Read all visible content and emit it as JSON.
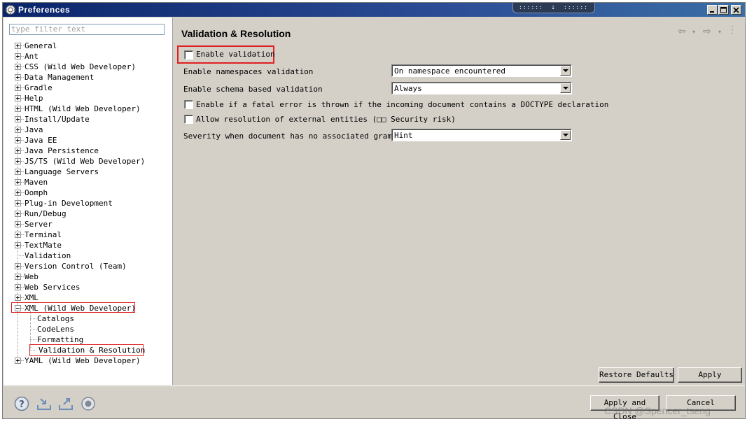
{
  "window": {
    "title": "Preferences",
    "controls": [
      "minimize-icon",
      "maximize-icon",
      "close-icon"
    ]
  },
  "filter": {
    "placeholder": "type filter text"
  },
  "tree": [
    {
      "label": "General",
      "expander": "plus"
    },
    {
      "label": "Ant",
      "expander": "plus"
    },
    {
      "label": "CSS (Wild Web Developer)",
      "expander": "plus"
    },
    {
      "label": "Data Management",
      "expander": "plus"
    },
    {
      "label": "Gradle",
      "expander": "plus"
    },
    {
      "label": "Help",
      "expander": "plus"
    },
    {
      "label": "HTML (Wild Web Developer)",
      "expander": "plus"
    },
    {
      "label": "Install/Update",
      "expander": "plus"
    },
    {
      "label": "Java",
      "expander": "plus"
    },
    {
      "label": "Java EE",
      "expander": "plus"
    },
    {
      "label": "Java Persistence",
      "expander": "plus"
    },
    {
      "label": "JS/TS (Wild Web Developer)",
      "expander": "plus"
    },
    {
      "label": "Language Servers",
      "expander": "plus"
    },
    {
      "label": "Maven",
      "expander": "plus"
    },
    {
      "label": "Oomph",
      "expander": "plus"
    },
    {
      "label": "Plug-in Development",
      "expander": "plus"
    },
    {
      "label": "Run/Debug",
      "expander": "plus"
    },
    {
      "label": "Server",
      "expander": "plus"
    },
    {
      "label": "Terminal",
      "expander": "plus"
    },
    {
      "label": "TextMate",
      "expander": "plus"
    },
    {
      "label": "Validation",
      "expander": "none"
    },
    {
      "label": "Version Control (Team)",
      "expander": "plus"
    },
    {
      "label": "Web",
      "expander": "plus"
    },
    {
      "label": "Web Services",
      "expander": "plus"
    },
    {
      "label": "XML",
      "expander": "plus"
    },
    {
      "label": "XML (Wild Web Developer)",
      "expander": "minus",
      "highlighted": true
    },
    {
      "label": "Catalogs",
      "expander": "child"
    },
    {
      "label": "CodeLens",
      "expander": "child"
    },
    {
      "label": "Formatting",
      "expander": "child"
    },
    {
      "label": "Validation & Resolution",
      "expander": "child",
      "selected": true,
      "highlighted": true
    },
    {
      "label": "YAML (Wild Web Developer)",
      "expander": "plus"
    }
  ],
  "page": {
    "title": "Validation & Resolution",
    "enable_validation": "Enable validation",
    "namespaces_label": "Enable namespaces validation",
    "namespaces_value": "On namespace encountered",
    "schema_label": "Enable schema based validation",
    "schema_value": "Always",
    "fatal_error_label": "Enable if a fatal error is thrown if the incoming document contains a DOCTYPE declaration",
    "external_entities_label": "Allow resolution of external entities (□□ Security risk)",
    "severity_label": "Severity when document has no associated grammar",
    "severity_value": "Hint",
    "restore_defaults": "Restore Defaults",
    "apply": "Apply"
  },
  "footer": {
    "apply_and_close": "Apply and Close",
    "cancel": "Cancel",
    "icons": [
      "help-icon",
      "import-icon",
      "export-icon",
      "oomph-record-icon"
    ]
  },
  "watermark": "CSDN @Spencer_tseng",
  "colors": {
    "highlight_red": "#e02020",
    "title_blue": "#0a246a",
    "dialog_gray": "#d4d0c8"
  }
}
